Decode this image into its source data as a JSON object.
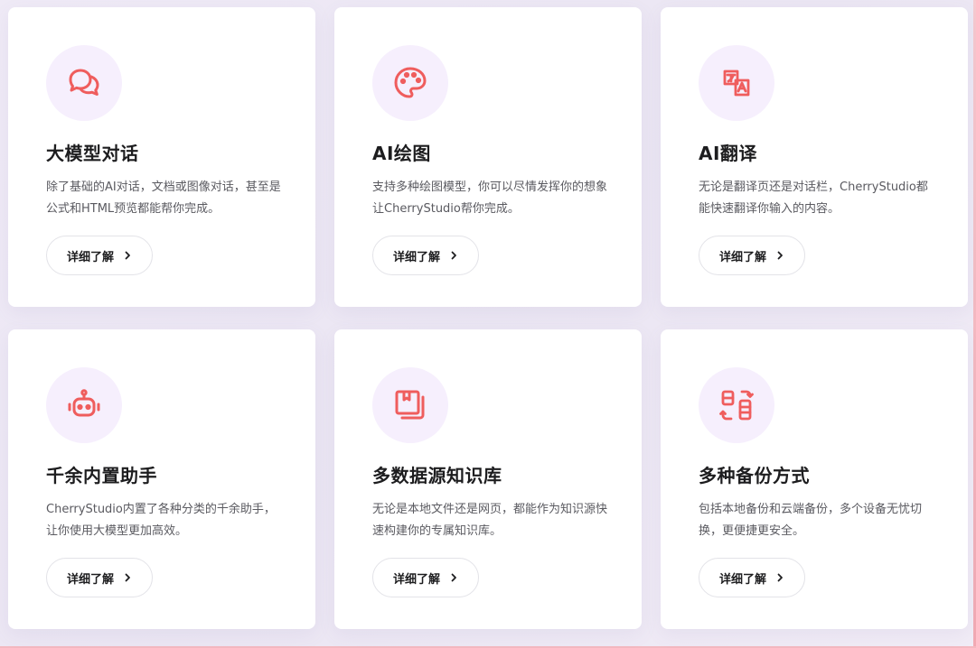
{
  "accent_color": "#ef5d5d",
  "icon_bg_color": "#f6effd",
  "cards": [
    {
      "icon": "chat-bubbles-icon",
      "title": "大模型对话",
      "desc": "除了基础的AI对话，文档或图像对话，甚至是公式和HTML预览都能帮你完成。",
      "button": "详细了解"
    },
    {
      "icon": "palette-icon",
      "title": "AI绘图",
      "desc": "支持多种绘图模型，你可以尽情发挥你的想象让CherryStudio帮你完成。",
      "button": "详细了解"
    },
    {
      "icon": "translate-icon",
      "title": "AI翻译",
      "desc": "无论是翻译页还是对话栏，CherryStudio都能快速翻译你输入的内容。",
      "button": "详细了解"
    },
    {
      "icon": "robot-icon",
      "title": "千余内置助手",
      "desc": "CherryStudio内置了各种分类的千余助手，让你使用大模型更加高效。",
      "button": "详细了解"
    },
    {
      "icon": "book-stack-icon",
      "title": "多数据源知识库",
      "desc": "无论是本地文件还是网页，都能作为知识源快速构建你的专属知识库。",
      "button": "详细了解"
    },
    {
      "icon": "backup-sync-icon",
      "title": "多种备份方式",
      "desc": "包括本地备份和云端备份，多个设备无忧切换，更便捷更安全。",
      "button": "详细了解"
    }
  ]
}
